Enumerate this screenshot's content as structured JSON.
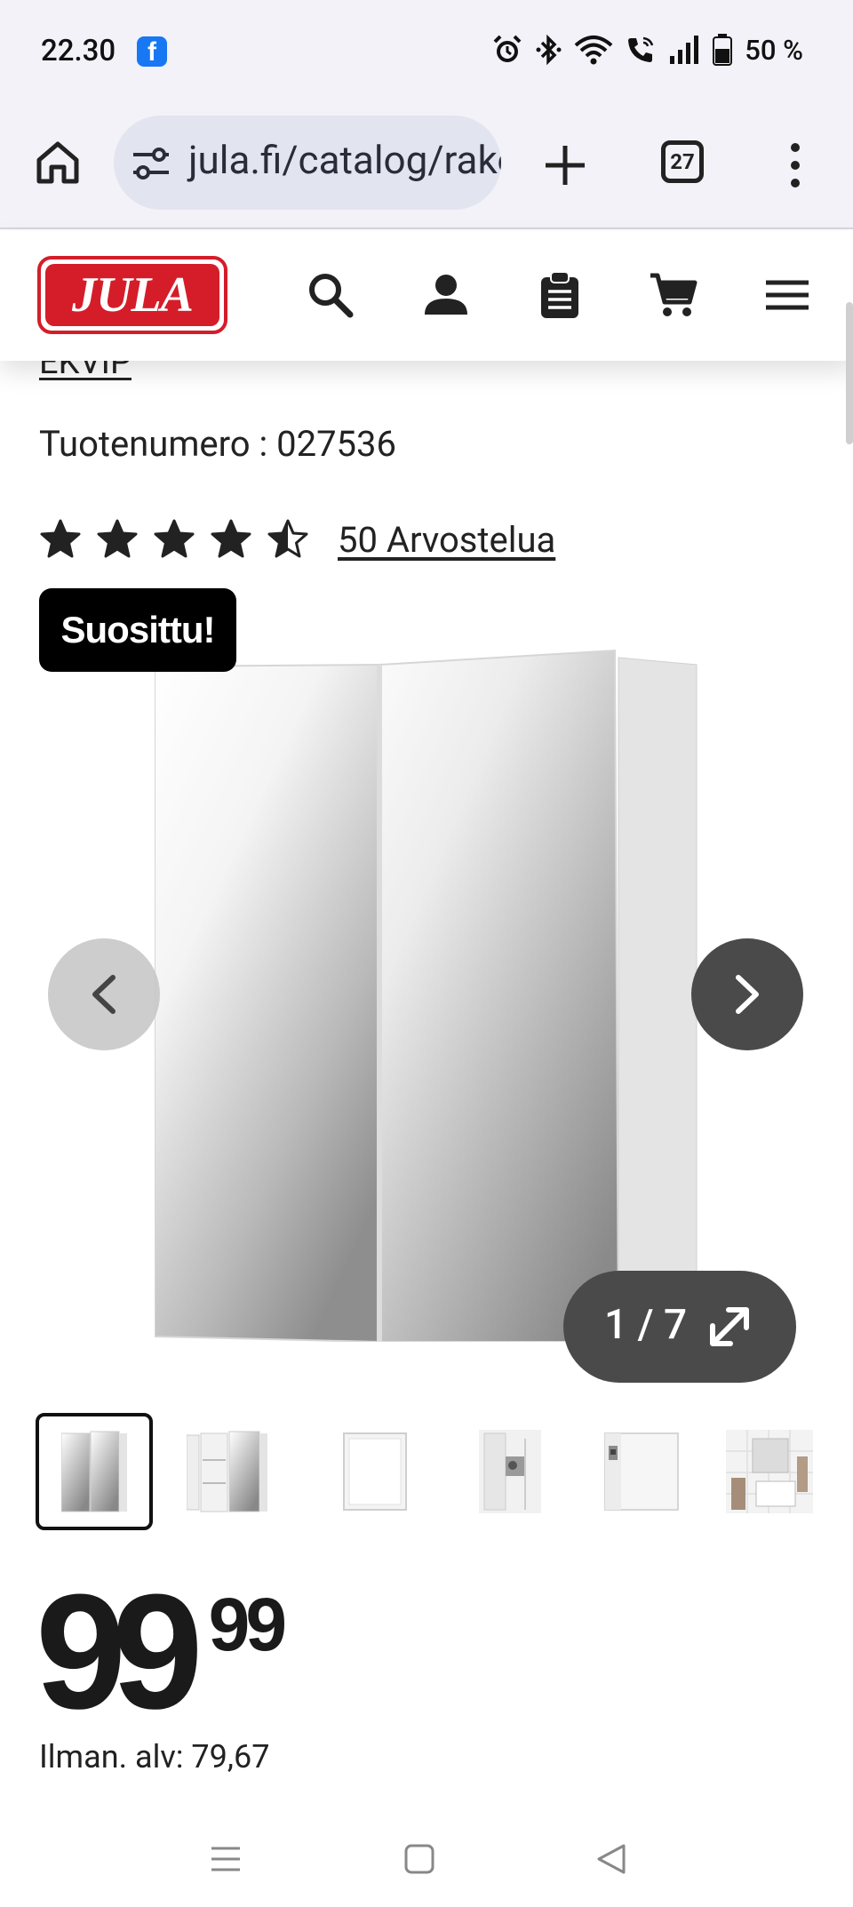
{
  "status_bar": {
    "time": "22.30",
    "notification_app": "f",
    "battery": "50 %",
    "icons": [
      "alarm-icon",
      "bluetooth-icon",
      "wifi-icon",
      "wifi-call-icon",
      "signal-icon",
      "battery-icon"
    ]
  },
  "browser": {
    "url": "jula.fi/catalog/rakennus",
    "tab_count": "27"
  },
  "site_header": {
    "logo_text": "JULA",
    "icons": [
      "search-icon",
      "account-icon",
      "shopping-list-icon",
      "cart-icon",
      "hamburger-menu-icon"
    ]
  },
  "product": {
    "brand": "EKVIP",
    "sku_label": "Tuotenumero : 027536",
    "rating_value": 4.5,
    "rating_max": 5,
    "reviews_label": "50 Arvostelua",
    "badge": "Suosittu!"
  },
  "gallery": {
    "counter": "1 / 7",
    "current": 1,
    "total": 7,
    "thumbnail_count": 6
  },
  "price": {
    "integer": "99",
    "decimal": "99",
    "vat_label": "Ilman. alv: 79,67"
  },
  "colors": {
    "brand_red": "#d51d29",
    "badge_bg": "#000000",
    "system_bar_bg": "#f2f2f8",
    "nav_button_dark": "#4a4a4a"
  }
}
